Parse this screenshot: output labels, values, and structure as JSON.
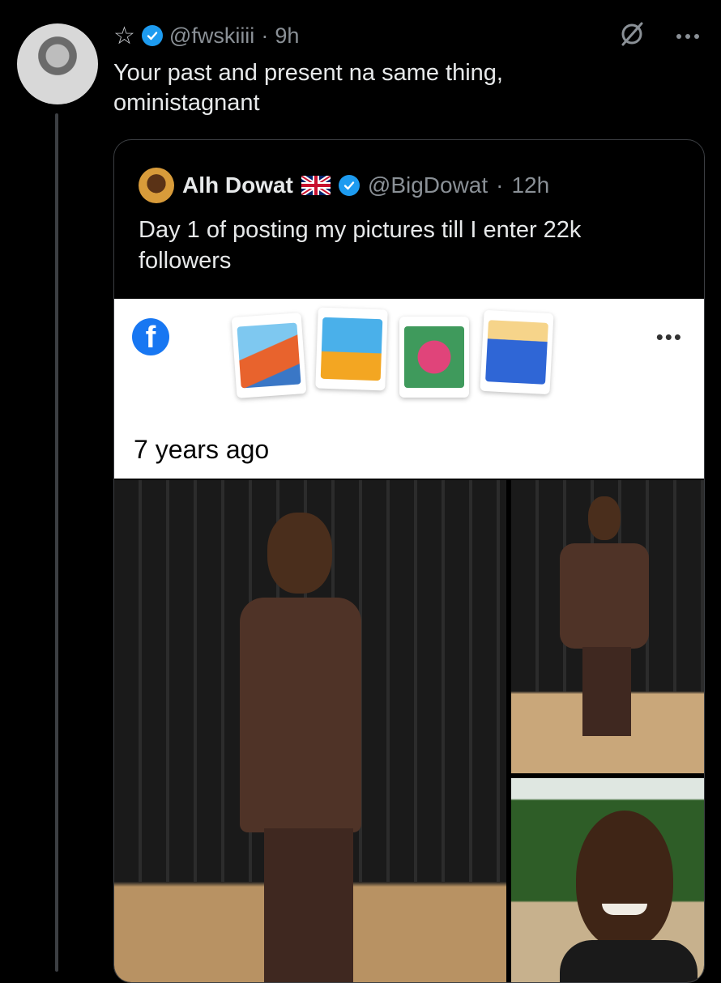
{
  "reply": {
    "handle": "@fwskiiii",
    "time": "9h",
    "text_line1": "Your past and present na same thing,",
    "text_line2": "oministagnant"
  },
  "quoted": {
    "name": "Alh Dowat",
    "handle": "@BigDowat",
    "time": "12h",
    "text_line1": "Day 1 of posting my pictures till I enter 22k",
    "text_line2": "followers"
  },
  "memory_card": {
    "label": "7 years ago",
    "logo_letter": "f"
  },
  "colors": {
    "background": "#000000",
    "verified_blue": "#1d9bf0",
    "facebook_blue": "#1877f2"
  },
  "icons": [
    "star-icon",
    "verified-badge-icon",
    "grok-icon",
    "more-icon",
    "uk-flag-icon",
    "facebook-logo-icon"
  ]
}
